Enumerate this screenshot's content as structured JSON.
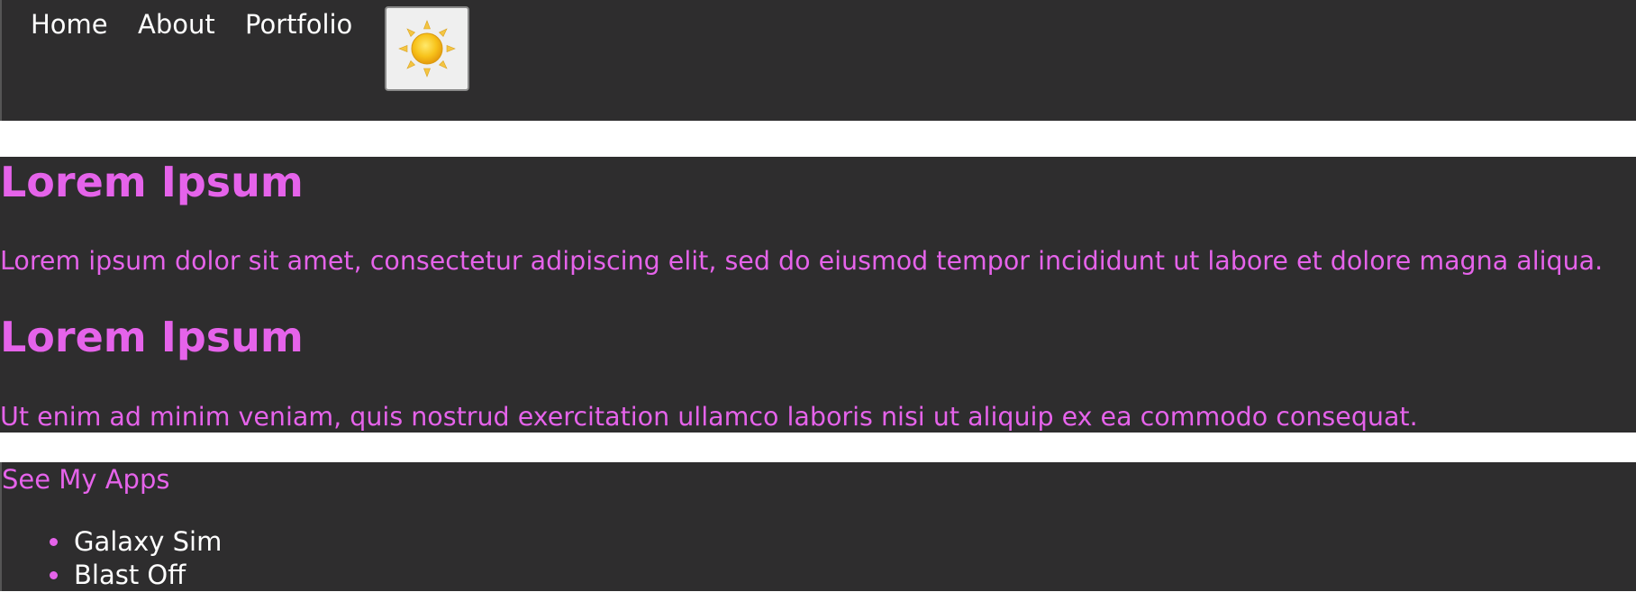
{
  "nav": {
    "links": [
      {
        "label": "Home"
      },
      {
        "label": "About"
      },
      {
        "label": "Portfolio"
      }
    ],
    "theme_toggle_icon": "sun-icon"
  },
  "main": {
    "sections": [
      {
        "heading": "Lorem Ipsum",
        "text": "Lorem ipsum dolor sit amet, consectetur adipiscing elit, sed do eiusmod tempor incididunt ut labore et dolore magna aliqua."
      },
      {
        "heading": "Lorem Ipsum",
        "text": "Ut enim ad minim veniam, quis nostrud exercitation ullamco laboris nisi ut aliquip ex ea commodo consequat."
      }
    ]
  },
  "apps": {
    "title": "See My Apps",
    "items": [
      {
        "label": "Galaxy Sim"
      },
      {
        "label": "Blast Off"
      }
    ]
  },
  "colors": {
    "background": "#2e2d2e",
    "accent": "#e563ea",
    "text": "#ffffff"
  }
}
